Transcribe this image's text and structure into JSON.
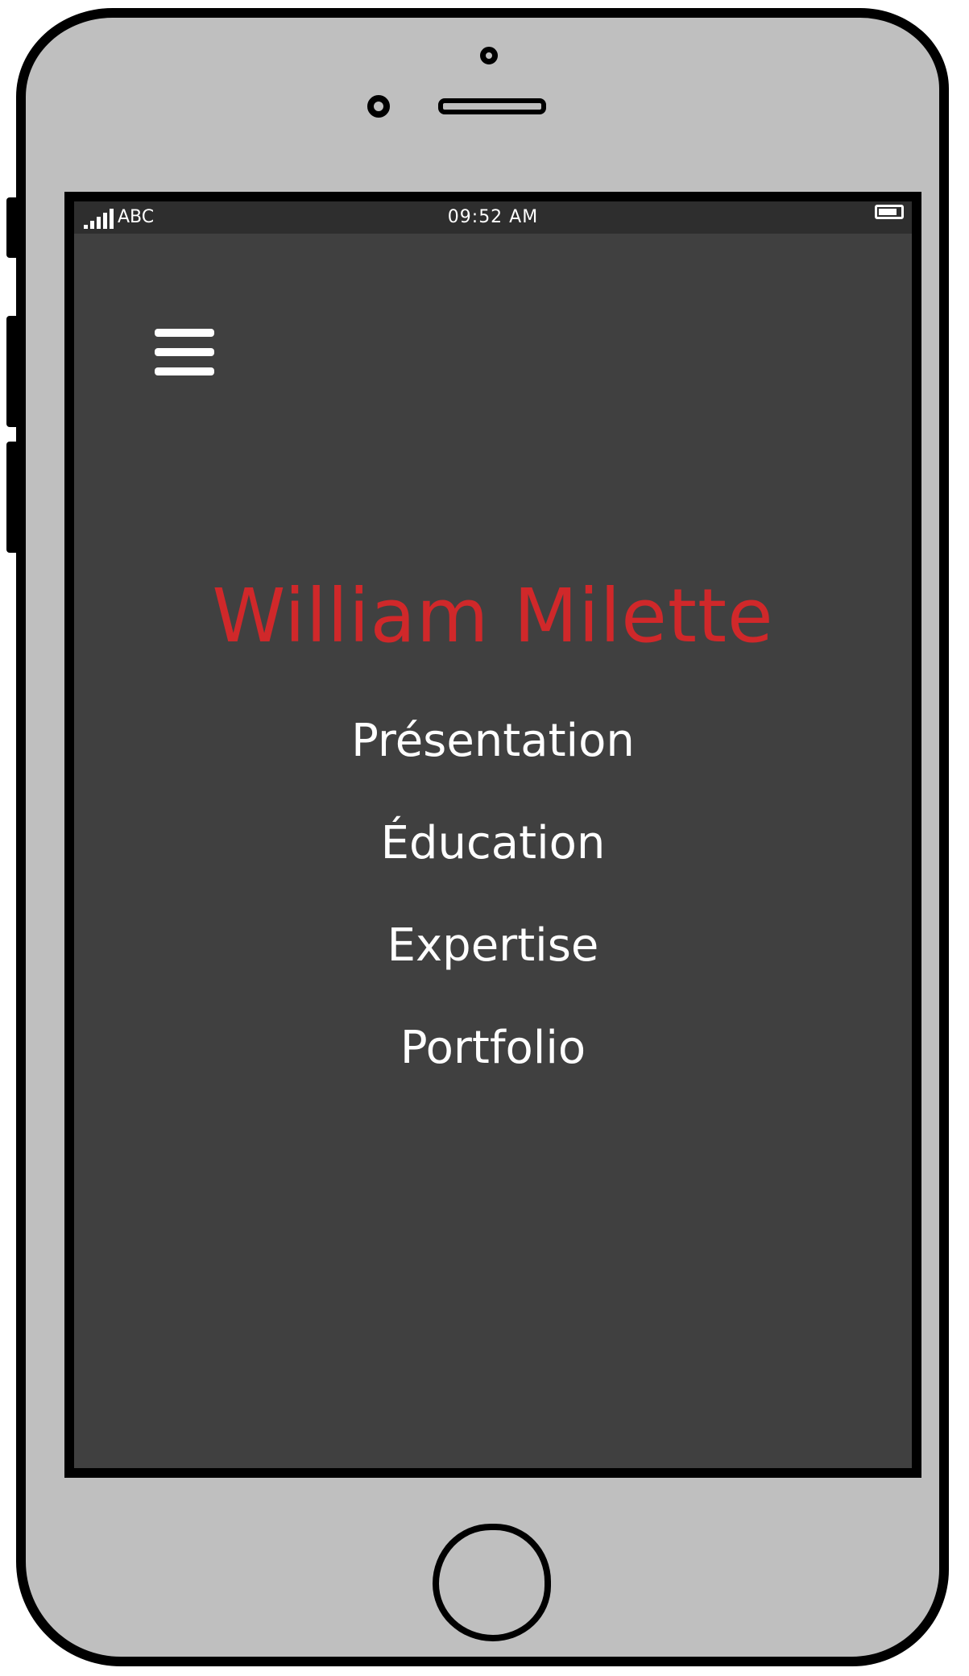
{
  "status_bar": {
    "carrier": "ABC",
    "time": "09:52 AM",
    "signal_icon": "signal-bars-icon",
    "battery_icon": "battery-icon"
  },
  "menu": {
    "icon": "hamburger-menu-icon"
  },
  "site": {
    "title": "William Milette",
    "title_color": "#d0282a"
  },
  "nav": {
    "items": [
      {
        "label": "Présentation"
      },
      {
        "label": "Éducation"
      },
      {
        "label": "Expertise"
      },
      {
        "label": "Portfolio"
      }
    ]
  },
  "colors": {
    "screen_background": "#404040",
    "device_body": "#bfbfbf",
    "text": "#ffffff"
  }
}
